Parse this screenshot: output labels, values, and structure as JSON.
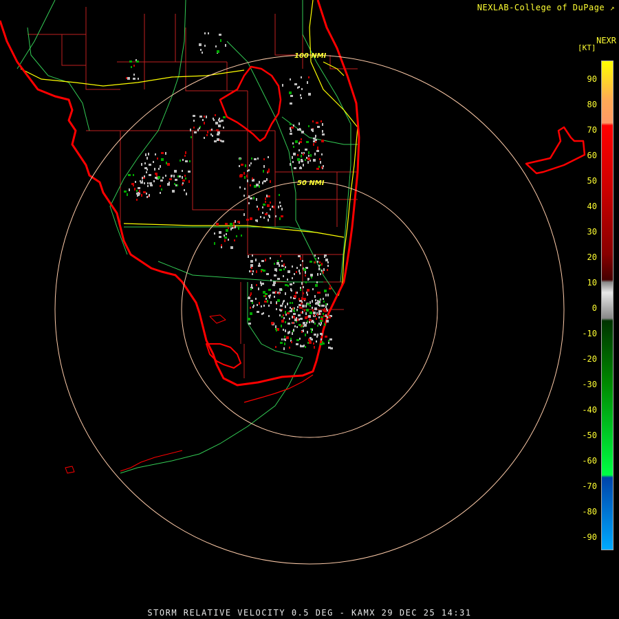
{
  "header": {
    "credit": "NEXLAB-College of DuPage",
    "product": "NEXR",
    "units": "[KT]"
  },
  "footer": {
    "caption": "STORM RELATIVE VELOCITY 0.5 DEG - KAMX 29 DEC 25 14:31"
  },
  "range_rings": [
    {
      "label": "50 NMI"
    },
    {
      "label": "100 NMI"
    }
  ],
  "colorbar": {
    "ticks": [
      "90",
      "80",
      "70",
      "60",
      "50",
      "40",
      "30",
      "20",
      "10",
      "0",
      "-10",
      "-20",
      "-30",
      "-40",
      "-50",
      "-60",
      "-70",
      "-80",
      "-90"
    ],
    "max": 95,
    "min": -95,
    "stops": [
      {
        "v": 95,
        "color": "#ffff00"
      },
      {
        "v": 80,
        "color": "#ffaa55"
      },
      {
        "v": 71,
        "color": "#ff9966"
      },
      {
        "v": 70,
        "color": "#ff0000"
      },
      {
        "v": 45,
        "color": "#cc0000"
      },
      {
        "v": 20,
        "color": "#880000"
      },
      {
        "v": 10,
        "color": "#440000"
      },
      {
        "v": 9,
        "color": "#888888"
      },
      {
        "v": 5,
        "color": "#e8e8e8"
      },
      {
        "v": -5,
        "color": "#888888"
      },
      {
        "v": -6,
        "color": "#003300"
      },
      {
        "v": -30,
        "color": "#008800"
      },
      {
        "v": -66,
        "color": "#00ff44"
      },
      {
        "v": -67,
        "color": "#0044aa"
      },
      {
        "v": -95,
        "color": "#00aaff"
      }
    ]
  },
  "colors": {
    "coast": "#ff0000",
    "county": "#c02020",
    "road": "#33cc55",
    "interstate": "#ffff00",
    "ring": "#ffccaa",
    "velocity_gray": "#c0c0c0",
    "velocity_green": "#00aa00",
    "velocity_red": "#cc0000"
  }
}
